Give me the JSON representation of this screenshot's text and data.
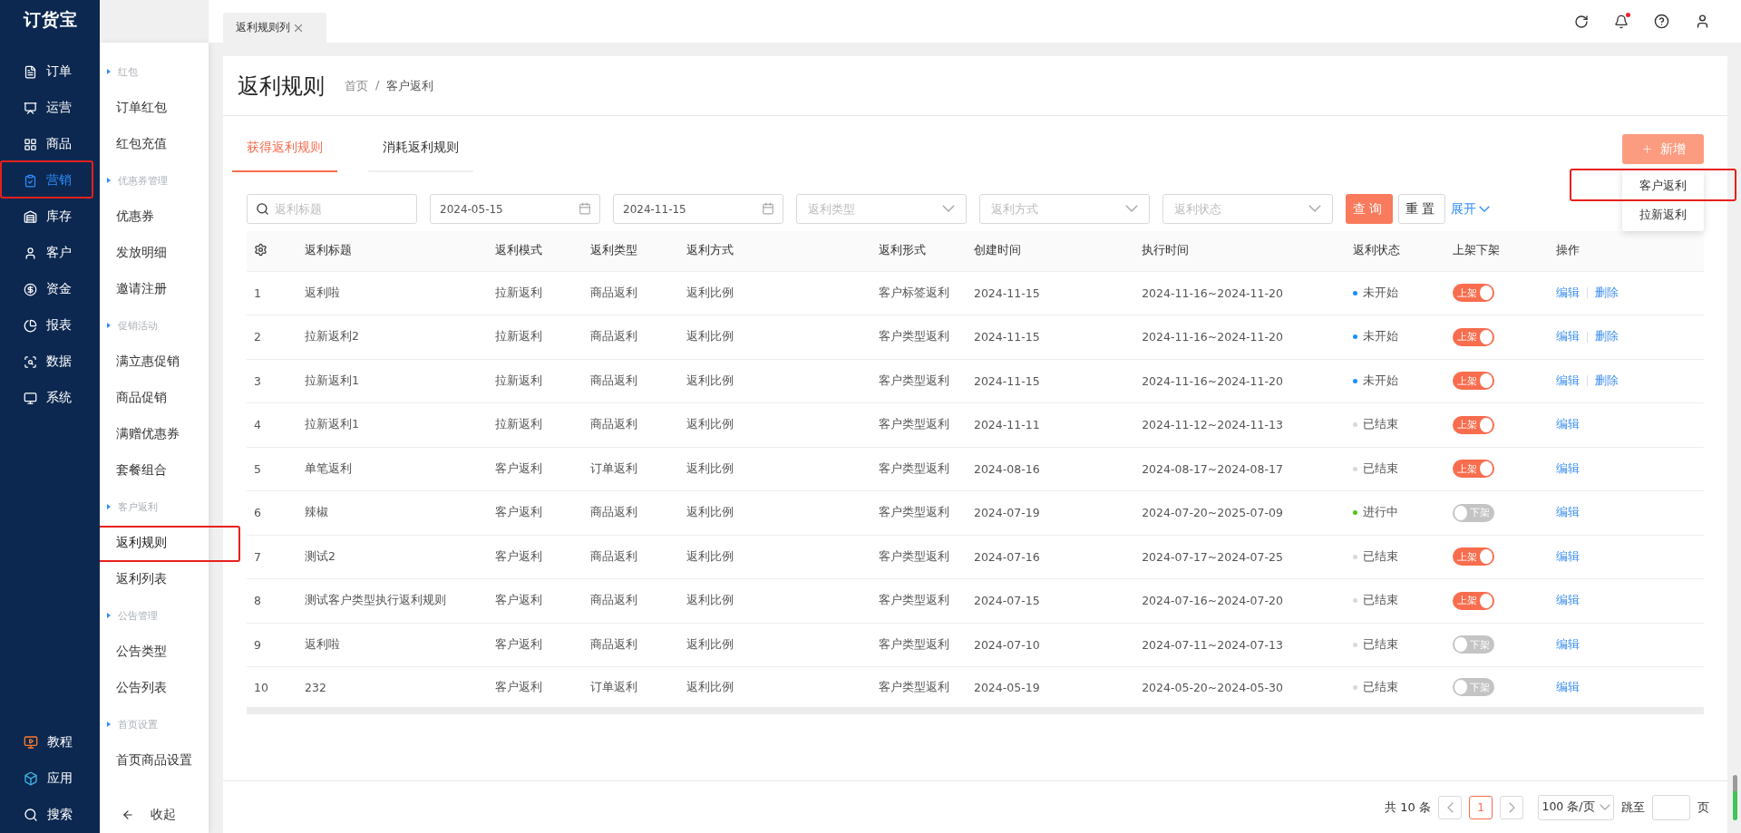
{
  "logo": "订货宝",
  "nav": {
    "items": [
      {
        "label": "订单",
        "selected": false,
        "highlighted": false
      },
      {
        "label": "运营",
        "selected": false,
        "highlighted": false
      },
      {
        "label": "商品",
        "selected": false,
        "highlighted": false
      },
      {
        "label": "营销",
        "selected": true,
        "highlighted": true
      },
      {
        "label": "库存",
        "selected": false,
        "highlighted": false
      },
      {
        "label": "客户",
        "selected": false,
        "highlighted": false
      },
      {
        "label": "资金",
        "selected": false,
        "highlighted": false
      },
      {
        "label": "报表",
        "selected": false,
        "highlighted": false
      },
      {
        "label": "数据",
        "selected": false,
        "highlighted": false
      },
      {
        "label": "系统",
        "selected": false,
        "highlighted": false
      }
    ],
    "bottom_items": [
      {
        "label": "教程"
      },
      {
        "label": "应用"
      },
      {
        "label": "搜索"
      }
    ]
  },
  "submenu": {
    "groups": [
      {
        "title": "红包",
        "items": [
          {
            "label": "订单红包",
            "selected": false,
            "highlighted": false
          },
          {
            "label": "红包充值",
            "selected": false,
            "highlighted": false
          }
        ]
      },
      {
        "title": "优惠券管理",
        "items": [
          {
            "label": "优惠券",
            "selected": false,
            "highlighted": false
          },
          {
            "label": "发放明细",
            "selected": false,
            "highlighted": false
          },
          {
            "label": "邀请注册",
            "selected": false,
            "highlighted": false
          }
        ]
      },
      {
        "title": "促销活动",
        "items": [
          {
            "label": "满立惠促销",
            "selected": false,
            "highlighted": false
          },
          {
            "label": "商品促销",
            "selected": false,
            "highlighted": false
          },
          {
            "label": "满赠优惠券",
            "selected": false,
            "highlighted": false
          },
          {
            "label": "套餐组合",
            "selected": false,
            "highlighted": false
          }
        ]
      },
      {
        "title": "客户返利",
        "items": [
          {
            "label": "返利规则",
            "selected": true,
            "highlighted": true
          },
          {
            "label": "返利列表",
            "selected": false,
            "highlighted": false
          }
        ]
      },
      {
        "title": "公告管理",
        "items": [
          {
            "label": "公告类型",
            "selected": false,
            "highlighted": false
          },
          {
            "label": "公告列表",
            "selected": false,
            "highlighted": false
          }
        ]
      },
      {
        "title": "首页设置",
        "items": [
          {
            "label": "首页商品设置",
            "selected": false,
            "highlighted": false
          }
        ]
      }
    ],
    "collapse": "收起"
  },
  "page_tabs": [
    {
      "label": "返利规则列",
      "selected": true
    }
  ],
  "notification_dot": true,
  "page": {
    "title": "返利规则",
    "breadcrumb": [
      "首页",
      "客户返利"
    ],
    "breadcrumb_separator": "/"
  },
  "tabs": [
    {
      "label": "获得返利规则",
      "selected": true
    },
    {
      "label": "消耗返利规则",
      "selected": false
    }
  ],
  "add_button": {
    "label": "新增",
    "menu": [
      {
        "label": "客户返利",
        "highlighted": true
      },
      {
        "label": "拉新返利",
        "highlighted": false
      }
    ]
  },
  "filters": [
    {
      "kind": "search",
      "placeholder": "返利标题"
    },
    {
      "kind": "date",
      "value": "2024-05-15"
    },
    {
      "kind": "date",
      "value": "2024-11-15"
    },
    {
      "kind": "select",
      "placeholder": "返利类型"
    },
    {
      "kind": "select",
      "placeholder": "返利方式"
    },
    {
      "kind": "select",
      "placeholder": "返利状态"
    }
  ],
  "query": "查询",
  "reset": "重置",
  "expand": "展开",
  "table": {
    "columns": [
      "返利标题",
      "返利模式",
      "返利类型",
      "返利方式",
      "返利形式",
      "创建时间",
      "执行时间",
      "返利状态",
      "上架下架",
      "操作"
    ],
    "rows": [
      {
        "index": "1",
        "cells": [
          "返利啦",
          "拉新返利",
          "商品返利",
          "返利比例",
          "客户标签返利",
          "2024-11-15",
          "2024-11-16~2024-11-20"
        ],
        "status": {
          "label": "未开始",
          "color": "#1890ff"
        },
        "listed": true,
        "toggle_label": "上架",
        "actions": [
          "编辑",
          "删除"
        ]
      },
      {
        "index": "2",
        "cells": [
          "拉新返利2",
          "拉新返利",
          "商品返利",
          "返利比例",
          "客户类型返利",
          "2024-11-15",
          "2024-11-16~2024-11-20"
        ],
        "status": {
          "label": "未开始",
          "color": "#1890ff"
        },
        "listed": true,
        "toggle_label": "上架",
        "actions": [
          "编辑",
          "删除"
        ]
      },
      {
        "index": "3",
        "cells": [
          "拉新返利1",
          "拉新返利",
          "商品返利",
          "返利比例",
          "客户类型返利",
          "2024-11-15",
          "2024-11-16~2024-11-20"
        ],
        "status": {
          "label": "未开始",
          "color": "#1890ff"
        },
        "listed": true,
        "toggle_label": "上架",
        "actions": [
          "编辑",
          "删除"
        ]
      },
      {
        "index": "4",
        "cells": [
          "拉新返利1",
          "拉新返利",
          "商品返利",
          "返利比例",
          "客户类型返利",
          "2024-11-11",
          "2024-11-12~2024-11-13"
        ],
        "status": {
          "label": "已结束",
          "color": "#d9d9d9"
        },
        "listed": true,
        "toggle_label": "上架",
        "actions": [
          "编辑"
        ]
      },
      {
        "index": "5",
        "cells": [
          "单笔返利",
          "客户返利",
          "订单返利",
          "返利比例",
          "客户类型返利",
          "2024-08-16",
          "2024-08-17~2024-08-17"
        ],
        "status": {
          "label": "已结束",
          "color": "#d9d9d9"
        },
        "listed": true,
        "toggle_label": "上架",
        "actions": [
          "编辑"
        ]
      },
      {
        "index": "6",
        "cells": [
          "辣椒",
          "客户返利",
          "商品返利",
          "返利比例",
          "客户类型返利",
          "2024-07-19",
          "2024-07-20~2025-07-09"
        ],
        "status": {
          "label": "进行中",
          "color": "#52c41a"
        },
        "listed": false,
        "toggle_label": "下架",
        "actions": [
          "编辑"
        ]
      },
      {
        "index": "7",
        "cells": [
          "测试2",
          "客户返利",
          "商品返利",
          "返利比例",
          "客户类型返利",
          "2024-07-16",
          "2024-07-17~2024-07-25"
        ],
        "status": {
          "label": "已结束",
          "color": "#d9d9d9"
        },
        "listed": true,
        "toggle_label": "上架",
        "actions": [
          "编辑"
        ]
      },
      {
        "index": "8",
        "cells": [
          "测试客户类型执行返利规则",
          "客户返利",
          "商品返利",
          "返利比例",
          "客户类型返利",
          "2024-07-15",
          "2024-07-16~2024-07-20"
        ],
        "status": {
          "label": "已结束",
          "color": "#d9d9d9"
        },
        "listed": true,
        "toggle_label": "上架",
        "actions": [
          "编辑"
        ]
      },
      {
        "index": "9",
        "cells": [
          "返利啦",
          "客户返利",
          "商品返利",
          "返利比例",
          "客户类型返利",
          "2024-07-10",
          "2024-07-11~2024-07-13"
        ],
        "status": {
          "label": "已结束",
          "color": "#d9d9d9"
        },
        "listed": false,
        "toggle_label": "下架",
        "actions": [
          "编辑"
        ]
      },
      {
        "index": "10",
        "cells": [
          "232",
          "客户返利",
          "订单返利",
          "返利比例",
          "客户类型返利",
          "2024-05-19",
          "2024-05-20~2024-05-30"
        ],
        "status": {
          "label": "已结束",
          "color": "#d9d9d9"
        },
        "listed": false,
        "toggle_label": "下架",
        "actions": [
          "编辑"
        ]
      }
    ]
  },
  "pagination": {
    "total": "共 10 条",
    "pages": [
      {
        "label": "1",
        "selected": true
      }
    ],
    "page_size": "100 条/页",
    "jump_label": "跳至",
    "page_unit": "页"
  }
}
